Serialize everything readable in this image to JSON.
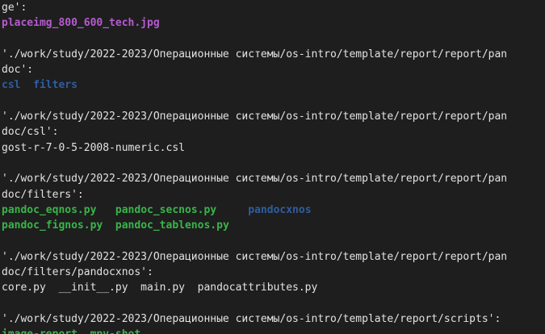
{
  "colors": {
    "background": "#1e1e1e",
    "plain_text": "#e2e2e2",
    "image_file": "#b65bd0",
    "directory": "#2f5d9f",
    "executable": "#39b54a"
  },
  "lines": [
    [
      {
        "text": "ge':",
        "kind": "plain"
      }
    ],
    [
      {
        "text": "placeimg_800_600_tech.jpg",
        "kind": "image"
      }
    ],
    [],
    [
      {
        "text": "'./work/study/2022-2023/Операционные системы/os-intro/template/report/report/pan",
        "kind": "plain"
      }
    ],
    [
      {
        "text": "doc':",
        "kind": "plain"
      }
    ],
    [
      {
        "text": "csl",
        "kind": "dir"
      },
      {
        "text": "  ",
        "kind": "plain"
      },
      {
        "text": "filters",
        "kind": "dir"
      }
    ],
    [],
    [
      {
        "text": "'./work/study/2022-2023/Операционные системы/os-intro/template/report/report/pan",
        "kind": "plain"
      }
    ],
    [
      {
        "text": "doc/csl':",
        "kind": "plain"
      }
    ],
    [
      {
        "text": "gost-r-7-0-5-2008-numeric.csl",
        "kind": "plain"
      }
    ],
    [],
    [
      {
        "text": "'./work/study/2022-2023/Операционные системы/os-intro/template/report/report/pan",
        "kind": "plain"
      }
    ],
    [
      {
        "text": "doc/filters':",
        "kind": "plain"
      }
    ],
    [
      {
        "text": "pandoc_eqnos.py",
        "kind": "exec"
      },
      {
        "text": "   ",
        "kind": "plain"
      },
      {
        "text": "pandoc_secnos.py",
        "kind": "exec"
      },
      {
        "text": "     ",
        "kind": "plain"
      },
      {
        "text": "pandocxnos",
        "kind": "dir"
      }
    ],
    [
      {
        "text": "pandoc_fignos.py",
        "kind": "exec"
      },
      {
        "text": "  ",
        "kind": "plain"
      },
      {
        "text": "pandoc_tablenos.py",
        "kind": "exec"
      }
    ],
    [],
    [
      {
        "text": "'./work/study/2022-2023/Операционные системы/os-intro/template/report/report/pan",
        "kind": "plain"
      }
    ],
    [
      {
        "text": "doc/filters/pandocxnos':",
        "kind": "plain"
      }
    ],
    [
      {
        "text": "core.py  __init__.py  main.py  pandocattributes.py",
        "kind": "plain"
      }
    ],
    [],
    [
      {
        "text": "'./work/study/2022-2023/Операционные системы/os-intro/template/report/scripts':",
        "kind": "plain"
      }
    ],
    [
      {
        "text": "image-report",
        "kind": "exec"
      },
      {
        "text": "  ",
        "kind": "plain"
      },
      {
        "text": "mpv-shot",
        "kind": "exec"
      }
    ]
  ]
}
